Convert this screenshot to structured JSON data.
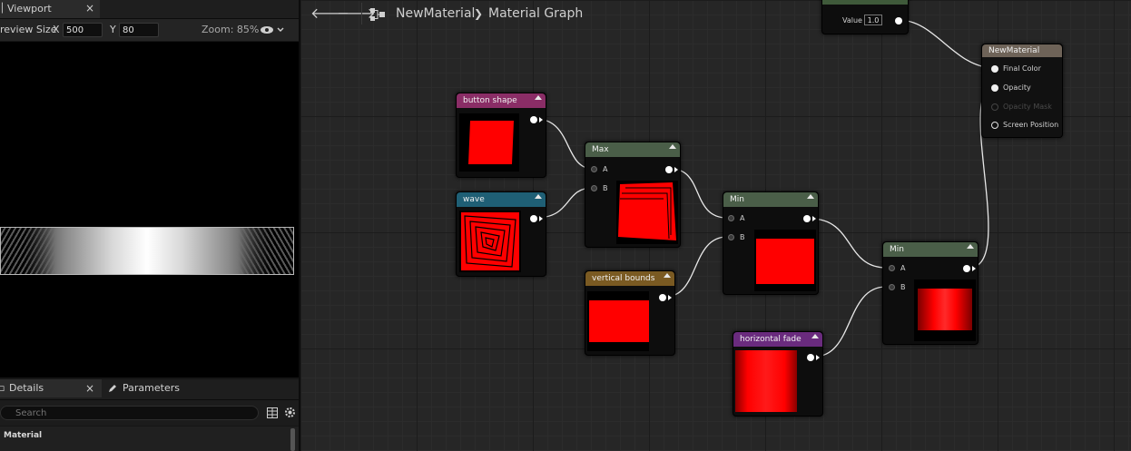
{
  "viewport_panel": {
    "tab_title": "Viewport",
    "close_glyph": "×",
    "toolbar": {
      "preview_size_label": "review Size",
      "x_label": "X",
      "x_value": "500",
      "y_label": "Y",
      "y_value": "80",
      "zoom_label": "Zoom: 85%",
      "eye_icon": "eye-icon",
      "dropdown_icon": "chevron-down-icon"
    }
  },
  "details_panel": {
    "tab_details": "Details",
    "tab_parameters": "Parameters",
    "close_glyph": "×",
    "search_placeholder": "Search",
    "section_title": "Material"
  },
  "graph": {
    "breadcrumb_asset": "NewMaterial",
    "breadcrumb_separator": "❯",
    "breadcrumb_graph": "Material Graph",
    "nodes": {
      "constant": {
        "value_label": "Value",
        "value": "1.0"
      },
      "result": {
        "title": "NewMaterial",
        "pins": [
          "Final Color",
          "Opacity",
          "Opacity Mask",
          "Screen Position"
        ]
      },
      "button_shape": {
        "title": "button shape"
      },
      "wave": {
        "title": "wave"
      },
      "max": {
        "title": "Max",
        "pin_a": "A",
        "pin_b": "B"
      },
      "min1": {
        "title": "Min",
        "pin_a": "A",
        "pin_b": "B"
      },
      "vertical_bounds": {
        "title": "vertical bounds"
      },
      "min2": {
        "title": "Min",
        "pin_a": "A",
        "pin_b": "B"
      },
      "horizontal_fade": {
        "title": "horizontal fade"
      }
    }
  },
  "colors": {
    "header_pink": "#8a2d66",
    "header_teal": "#1f5f75",
    "header_green": "#4a5e48",
    "header_orange": "#7a5a22",
    "header_purple": "#6a2b7e",
    "header_result": "#6e6358",
    "preview_red": "#ff0000"
  }
}
